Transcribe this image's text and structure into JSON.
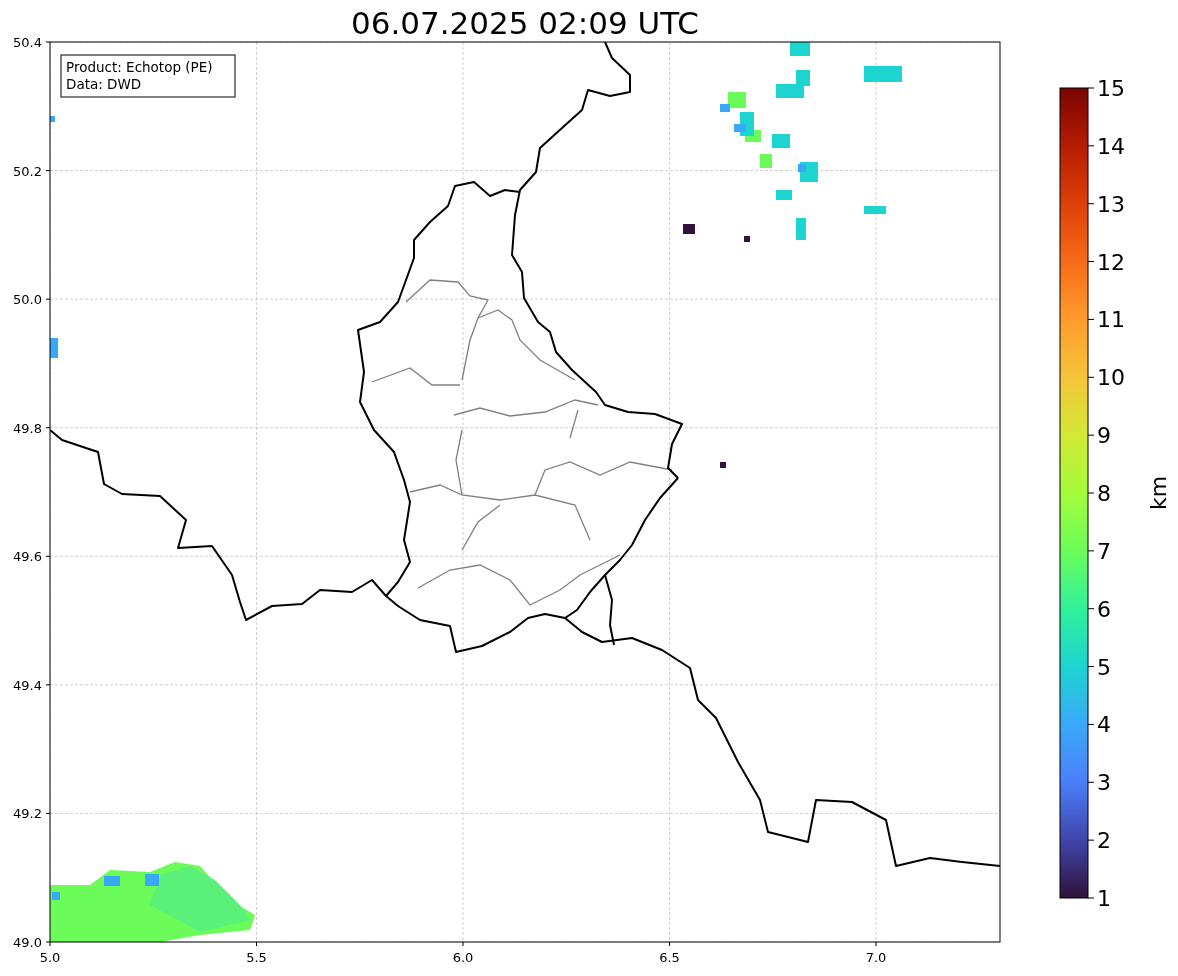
{
  "title": "06.07.2025 02:09 UTC",
  "legend": {
    "lines": [
      "Product: Echotop (PE)",
      "Data: DWD"
    ]
  },
  "axes": {
    "xticks": [
      "5.0",
      "5.5",
      "6.0",
      "6.5",
      "7.0"
    ],
    "yticks": [
      "50.4",
      "50.2",
      "50.0",
      "49.8",
      "49.6",
      "49.4",
      "49.2",
      "49.0"
    ]
  },
  "colorbar": {
    "label": "km",
    "ticks": [
      "15",
      "14",
      "13",
      "12",
      "11",
      "10",
      "9",
      "8",
      "7",
      "6",
      "5",
      "4",
      "3",
      "2",
      "1"
    ]
  }
}
